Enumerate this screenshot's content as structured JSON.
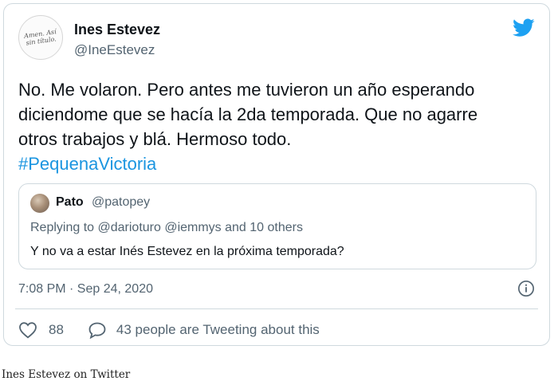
{
  "tweet": {
    "author_name": "Ines Estevez",
    "author_handle": "@IneEstevez",
    "avatar_text": "Amen. Así sin título.",
    "body_lines": [
      "No. Me volaron. Pero antes me tuvieron un año esperando",
      "diciendome que se hacía la 2da temporada. Que no agarre",
      "otros trabajos y blá. Hermoso todo."
    ],
    "hashtag": "#PequenaVictoria",
    "timestamp": "7:08 PM · Sep 24, 2020",
    "like_count": "88",
    "reply_text": "43 people are Tweeting about this"
  },
  "quoted_tweet": {
    "author_name": "Pato",
    "author_handle": "@patopey",
    "replying_to": "Replying to @darioturo @iemmys and 10 others",
    "text": "Y no va a estar Inés Estevez en la próxima temporada?"
  },
  "caption": "Ines Estevez on Twitter",
  "colors": {
    "hashtag": "#1b95e0",
    "twitter_blue": "#1da1f2",
    "secondary_text": "#536471",
    "border": "#cfd9de"
  },
  "icons": {
    "brand": "twitter-bird-icon",
    "info": "info-icon",
    "like": "heart-icon",
    "reply": "speech-bubble-icon"
  }
}
